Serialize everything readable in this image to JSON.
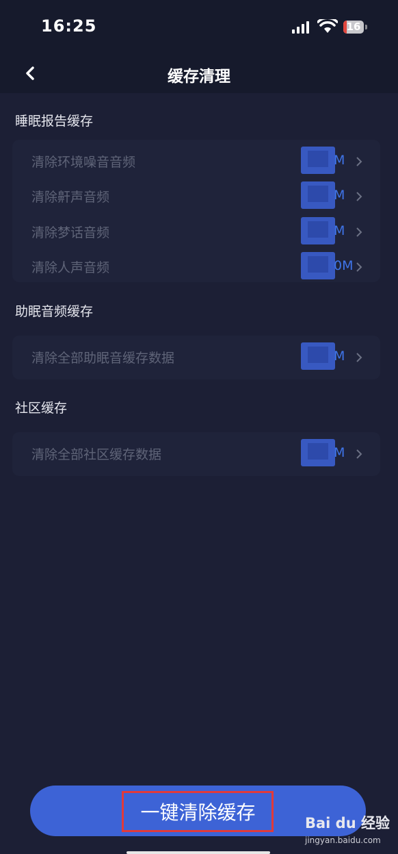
{
  "status_bar": {
    "time": "16:25",
    "battery": "16",
    "battery_level": 0.16,
    "icons": [
      "signal-icon",
      "wifi-icon",
      "battery-icon"
    ]
  },
  "nav": {
    "title": "缓存清理",
    "back_icon": "chevron-left-icon"
  },
  "sections": [
    {
      "title": "睡眠报告缓存",
      "items": [
        {
          "label": "清除环境噪音音频",
          "size": "M"
        },
        {
          "label": "清除鼾声音频",
          "size": "M"
        },
        {
          "label": "清除梦话音频",
          "size": "M"
        },
        {
          "label": "清除人声音频",
          "size": "0M"
        }
      ]
    },
    {
      "title": "助眠音频缓存",
      "items": [
        {
          "label": "清除全部助眠音缓存数据",
          "size": "M"
        }
      ]
    },
    {
      "title": "社区缓存",
      "items": [
        {
          "label": "清除全部社区缓存数据",
          "size": "M"
        }
      ]
    }
  ],
  "clear_all_button": {
    "label": "一键清除缓存"
  },
  "watermark": {
    "brand": "Bai du 经验",
    "url": "jingyan.baidu.com"
  },
  "colors": {
    "background": "#1c1f35",
    "accent": "#3d63d6",
    "size_text": "#3f74e8",
    "highlight": "#e23a3a"
  }
}
